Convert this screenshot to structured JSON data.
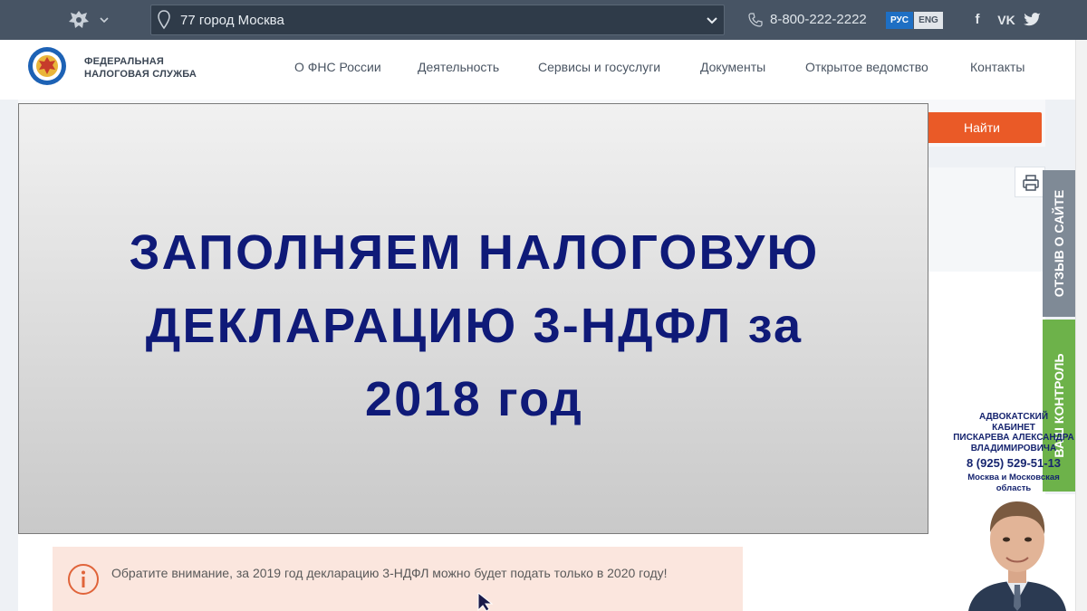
{
  "topbar": {
    "region_text": "77 город Москва",
    "phone": "8-800-222-2222",
    "lang_ru": "РУС",
    "lang_en": "ENG",
    "social": {
      "facebook": "f",
      "vk": "VK",
      "twitter": "🐦"
    }
  },
  "header": {
    "org_line1": "ФЕДЕРАЛЬНАЯ",
    "org_line2": "НАЛОГОВАЯ СЛУЖБА",
    "nav": [
      "О ФНС России",
      "Деятельность",
      "Сервисы и госуслуги",
      "Документы",
      "Открытое ведомство",
      "Контакты"
    ]
  },
  "search": {
    "button_label": "Найти"
  },
  "side_tabs": {
    "feedback": "ОТЗЫВ О САЙТЕ",
    "control": "ВАШ КОНТРОЛЬ"
  },
  "notice": {
    "text": "Обратите внимание, за 2019 год декларацию 3-НДФЛ можно будет подать только в 2020 году!"
  },
  "banner": {
    "line1": "ЗАПОЛНЯЕМ НАЛОГОВУЮ",
    "line2": "ДЕКЛАРАЦИЮ 3-НДФЛ за",
    "line3": "2018 год"
  },
  "ad": {
    "line1": "АДВОКАТСКИЙ",
    "line2": "КАБИНЕТ",
    "line3": "ПИСКАРЕВА АЛЕКСАНДРА",
    "line4": "ВЛАДИМИРОВИЧА",
    "phone": "8 (925) 529-51-13",
    "region_line1": "Москва и Московская",
    "region_line2": "область"
  },
  "colors": {
    "topbar": "#475464",
    "find_button": "#ea5a27",
    "banner_text": "#0f1a78",
    "control_tab": "#6db24a",
    "feedback_tab": "#7f8a96"
  },
  "icons": [
    "emblem-icon",
    "chevron-down-icon",
    "location-pin-icon",
    "phone-icon",
    "facebook-icon",
    "vk-icon",
    "twitter-icon",
    "fns-logo-icon",
    "print-icon",
    "info-icon",
    "cursor-icon"
  ]
}
